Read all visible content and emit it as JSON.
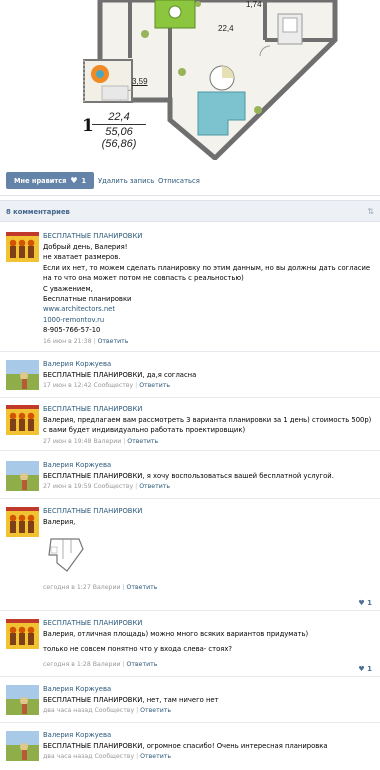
{
  "plan": {
    "apt_number": "1",
    "area_living": "22,4",
    "area_total": "55,06",
    "area_full": "(56,86)",
    "room_area_1": "22,4",
    "room_area_2": "3,59",
    "room_area_3": "1,74"
  },
  "actions": {
    "like_label": "Мне нравится",
    "like_count": "1",
    "delete_label": "Удалить запись",
    "unsubscribe_label": "Отписаться"
  },
  "comments_header": {
    "count_label": "8 комментариев"
  },
  "comments": [
    {
      "author": "БЕСПЛАТНЫЕ ПЛАНИРОВКИ",
      "lines": [
        "Добрый день, Валерия!",
        "не хватает размеров.",
        "Если их нет, то можем сделать планировку по этим данным, но вы должны дать согласие на то что она может потом не совпасть с реальностью)",
        "С уважением,",
        "Бесплатные планировки"
      ],
      "link1": "www.architectors.net",
      "link2": "1000-remontov.ru",
      "phone": "8-905-766-57-10",
      "date": "16 июн в 21:38",
      "reply": "Ответить"
    },
    {
      "author": "Валерия Коржуева",
      "text": "БЕСПЛАТНЫЕ ПЛАНИРОВКИ, да,я согласна",
      "date": "17 июн в 12:42 Сообществу",
      "reply": "Ответить"
    },
    {
      "author": "БЕСПЛАТНЫЕ ПЛАНИРОВКИ",
      "text": "Валерия, предлагаем вам рассмотреть 3 варианта планировки за 1 день) стоимость 500р) с вами будет индивидуально работать проектировщик)",
      "date": "27 июн в 19:48 Валерии",
      "reply": "Ответить"
    },
    {
      "author": "Валерия Коржуева",
      "text": "БЕСПЛАТНЫЕ ПЛАНИРОВКИ, я хочу воспользоваться вашей бесплатной услугой.",
      "date": "27 июн в 19:59 Сообществу",
      "reply": "Ответить"
    },
    {
      "author": "БЕСПЛАТНЫЕ ПЛАНИРОВКИ",
      "text": "Валерия,",
      "date": "сегодня в 1:27 Валерии",
      "reply": "Ответить",
      "likes": "1"
    },
    {
      "author": "БЕСПЛАТНЫЕ ПЛАНИРОВКИ",
      "text": "Валерия, отличная площадь) можно много всяких вариантов придумать)",
      "text2": "только не совсем понятно что у входа слева- стоях?",
      "date": "сегодня в 1:28 Валерии",
      "reply": "Ответить",
      "likes": "1"
    },
    {
      "author": "Валерия Коржуева",
      "text": "БЕСПЛАТНЫЕ ПЛАНИРОВКИ, нет, там ничего нет",
      "date": "два часа назад Сообществу",
      "reply": "Ответить"
    },
    {
      "author": "Валерия Коржуева",
      "text": "БЕСПЛАТНЫЕ ПЛАНИРОВКИ, огромное спасибо! Очень интересная планировка",
      "date": "два часа назад Сообществу",
      "reply": "Ответить"
    }
  ],
  "colors": {
    "link": "#2b587a",
    "button": "#6383a8",
    "header_bg": "#edf0f4"
  }
}
